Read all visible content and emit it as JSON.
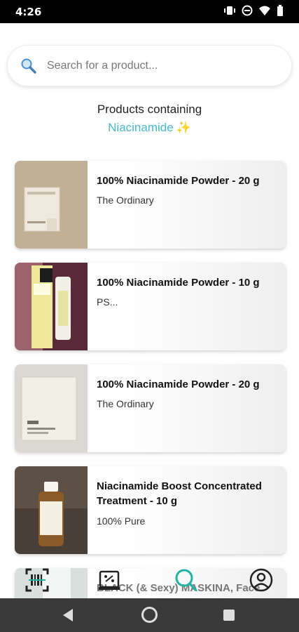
{
  "status_bar": {
    "time": "4:26",
    "icons": [
      "vibrate-icon",
      "dnd-icon",
      "wifi-icon",
      "battery-icon"
    ]
  },
  "search": {
    "placeholder": "Search for a product...",
    "icon": "search-icon"
  },
  "heading": {
    "line1": "Products containing",
    "ingredient": "Niacinamide",
    "sparkle": "✨"
  },
  "products": [
    {
      "title": "100% Niacinamide Powder - 20 g",
      "brand": "The Ordinary"
    },
    {
      "title": "100% Niacinamide Powder - 10 g",
      "brand": "PS..."
    },
    {
      "title": "100% Niacinamide Powder - 20 g",
      "brand": "The Ordinary"
    },
    {
      "title": "Niacinamide Boost Concentrated Treatment - 10 g",
      "brand": "100% Pure"
    },
    {
      "title": "BLACK (& Sexy) MASKINA, Face",
      "brand": ""
    }
  ],
  "bottom_nav": [
    {
      "name": "scan-tab",
      "icon": "barcode-scan-icon"
    },
    {
      "name": "compare-tab",
      "icon": "compare-icon"
    },
    {
      "name": "search-tab",
      "icon": "search-icon",
      "active_color": "#22b3a3"
    },
    {
      "name": "profile-tab",
      "icon": "user-icon"
    }
  ],
  "colors": {
    "accent": "#47b9cc",
    "active_tab": "#22b3a3"
  }
}
